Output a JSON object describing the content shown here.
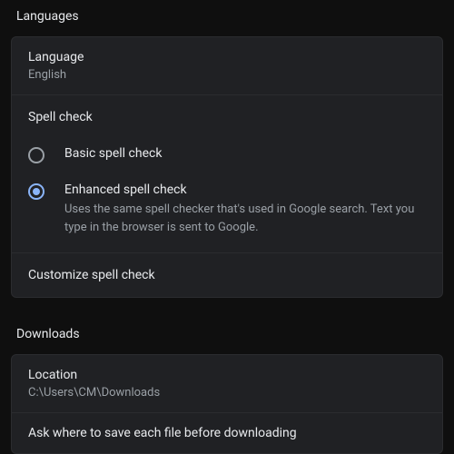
{
  "languages": {
    "section_title": "Languages",
    "language_row": {
      "label": "Language",
      "value": "English"
    },
    "spellcheck_title": "Spell check",
    "options": [
      {
        "label": "Basic spell check",
        "desc": ""
      },
      {
        "label": "Enhanced spell check",
        "desc": "Uses the same spell checker that's used in Google search. Text you type in the browser is sent to Google."
      }
    ],
    "selected_index": 1,
    "customize_label": "Customize spell check"
  },
  "downloads": {
    "section_title": "Downloads",
    "location_row": {
      "label": "Location",
      "value": "C:\\Users\\CM\\Downloads"
    },
    "ask_row_label": "Ask where to save each file before downloading"
  }
}
